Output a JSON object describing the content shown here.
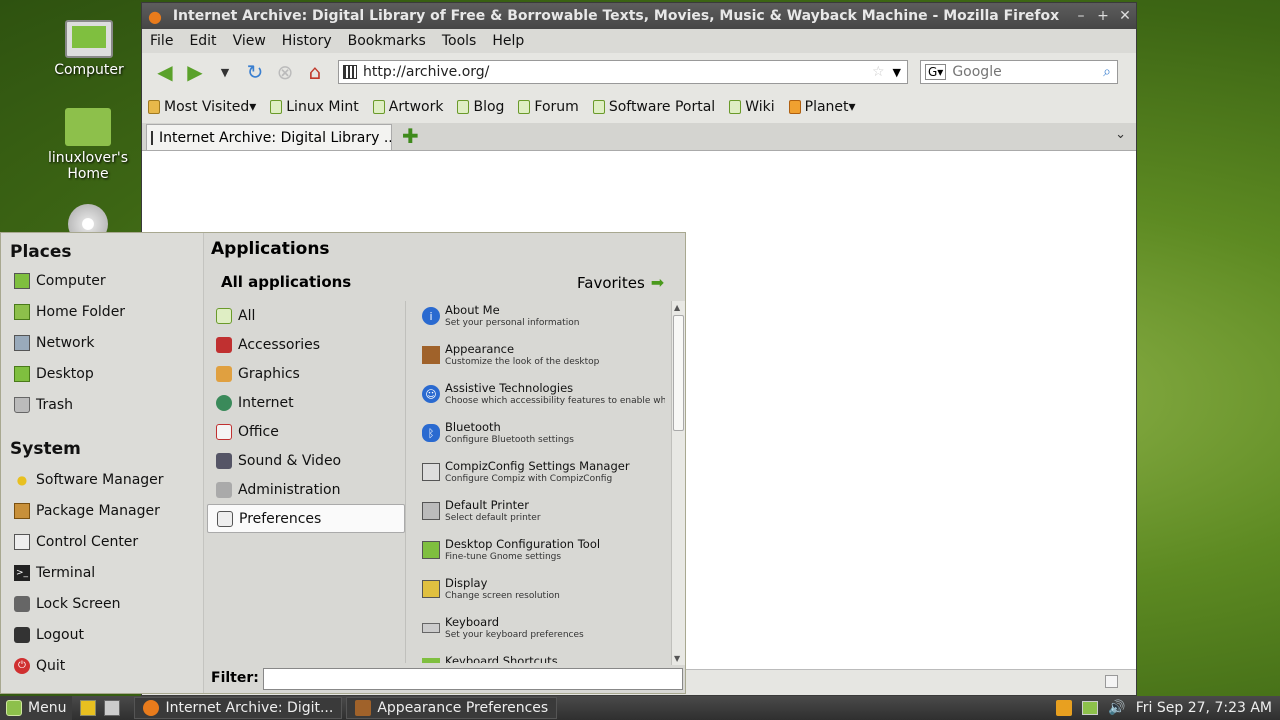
{
  "desktop": {
    "icons": [
      {
        "label": "Computer"
      },
      {
        "label": "linuxlover's Home"
      }
    ]
  },
  "firefox": {
    "title": "Internet Archive: Digital Library of Free & Borrowable Texts, Movies, Music & Wayback Machine - Mozilla Firefox",
    "menu": [
      "File",
      "Edit",
      "View",
      "History",
      "Bookmarks",
      "Tools",
      "Help"
    ],
    "url": "http://archive.org/",
    "search_placeholder": "Google",
    "bookmarks": [
      "Most Visited",
      "Linux Mint",
      "Artwork",
      "Blog",
      "Forum",
      "Software Portal",
      "Wiki",
      "Planet"
    ],
    "tab_title": "Internet Archive: Digital Library ..."
  },
  "mint_menu": {
    "places_title": "Places",
    "places": [
      "Computer",
      "Home Folder",
      "Network",
      "Desktop",
      "Trash"
    ],
    "system_title": "System",
    "system": [
      "Software Manager",
      "Package Manager",
      "Control Center",
      "Terminal",
      "Lock Screen",
      "Logout",
      "Quit"
    ],
    "applications_title": "Applications",
    "all_applications": "All applications",
    "favorites": "Favorites",
    "categories": [
      "All",
      "Accessories",
      "Graphics",
      "Internet",
      "Office",
      "Sound & Video",
      "Administration",
      "Preferences"
    ],
    "apps": [
      {
        "name": "About Me",
        "desc": "Set your personal information"
      },
      {
        "name": "Appearance",
        "desc": "Customize the look of the desktop"
      },
      {
        "name": "Assistive Technologies",
        "desc": "Choose which accessibility features to enable whe..."
      },
      {
        "name": "Bluetooth",
        "desc": "Configure Bluetooth settings"
      },
      {
        "name": "CompizConfig Settings Manager",
        "desc": "Configure Compiz with CompizConfig"
      },
      {
        "name": "Default Printer",
        "desc": "Select default printer"
      },
      {
        "name": "Desktop Configuration Tool",
        "desc": "Fine-tune Gnome settings"
      },
      {
        "name": "Display",
        "desc": "Change screen resolution"
      },
      {
        "name": "Keyboard",
        "desc": "Set your keyboard preferences"
      },
      {
        "name": "Keyboard Shortcuts",
        "desc": ""
      }
    ],
    "filter_label": "Filter:"
  },
  "taskbar": {
    "menu_label": "Menu",
    "tasks": [
      "Internet Archive: Digit...",
      "Appearance Preferences"
    ],
    "clock": "Fri Sep 27,  7:23 AM"
  },
  "colors": {
    "mint_green": "#5d8a22",
    "panel_dark": "#3a3a3a",
    "accent_green": "#4a9a1c"
  }
}
